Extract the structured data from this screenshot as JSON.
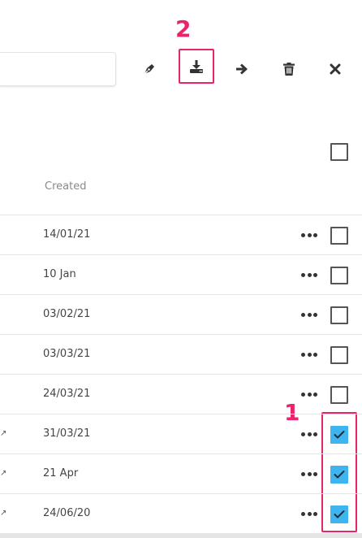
{
  "toolbar": {
    "search_value": "",
    "icons": [
      "pen-icon",
      "download-icon",
      "arrow-right-icon",
      "trash-icon",
      "close-icon"
    ]
  },
  "annotations": {
    "label_1": "1",
    "label_2": "2",
    "color": "#e8246b"
  },
  "table": {
    "header_created": "Created",
    "rows": [
      {
        "created": "14/01/21",
        "checked": false,
        "edge": ""
      },
      {
        "created": "10 Jan",
        "checked": false,
        "edge": ""
      },
      {
        "created": "03/02/21",
        "checked": false,
        "edge": ""
      },
      {
        "created": "03/03/21",
        "checked": false,
        "edge": ""
      },
      {
        "created": "24/03/21",
        "checked": false,
        "edge": ""
      },
      {
        "created": "31/03/21",
        "checked": true,
        "edge": "↗"
      },
      {
        "created": "21 Apr",
        "checked": true,
        "edge": "↗"
      },
      {
        "created": "24/06/20",
        "checked": true,
        "edge": "↗"
      }
    ]
  },
  "colors": {
    "checkbox_checked": "#3fb5ef",
    "icon": "#333333"
  }
}
